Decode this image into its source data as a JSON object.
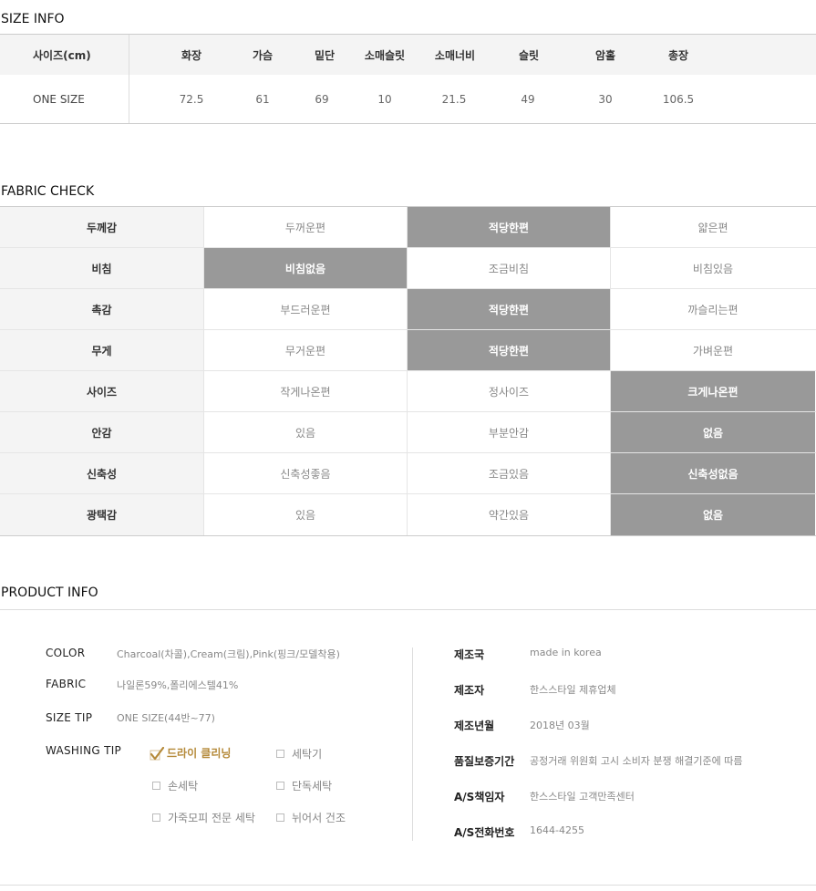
{
  "size_info": {
    "title": "SIZE INFO",
    "header_first": "사이즈(cm)",
    "columns": [
      "화장",
      "가슴",
      "밑단",
      "소매슬릿",
      "소매너비",
      "슬릿",
      "암홀",
      "총장"
    ],
    "row_label": "ONE SIZE",
    "values": [
      "72.5",
      "61",
      "69",
      "10",
      "21.5",
      "49",
      "30",
      "106.5"
    ]
  },
  "fabric_check": {
    "title": "FABRIC CHECK",
    "rows": [
      {
        "label": "두께감",
        "options": [
          "두꺼운편",
          "적당한편",
          "얇은편"
        ],
        "selected": 1
      },
      {
        "label": "비침",
        "options": [
          "비침없음",
          "조금비침",
          "비침있음"
        ],
        "selected": 0
      },
      {
        "label": "촉감",
        "options": [
          "부드러운편",
          "적당한편",
          "까슬리는편"
        ],
        "selected": 1
      },
      {
        "label": "무게",
        "options": [
          "무거운편",
          "적당한편",
          "가벼운편"
        ],
        "selected": 1
      },
      {
        "label": "사이즈",
        "options": [
          "작게나온편",
          "정사이즈",
          "크게나온편"
        ],
        "selected": 2
      },
      {
        "label": "안감",
        "options": [
          "있음",
          "부분안감",
          "없음"
        ],
        "selected": 2
      },
      {
        "label": "신축성",
        "options": [
          "신축성좋음",
          "조금있음",
          "신축성없음"
        ],
        "selected": 2
      },
      {
        "label": "광택감",
        "options": [
          "있음",
          "약간있음",
          "없음"
        ],
        "selected": 2
      }
    ],
    "selected_color": "#999999"
  },
  "product_info": {
    "title": "PRODUCT INFO",
    "color_label": "COLOR",
    "color_value": "Charcoal(차콜),Cream(크림),Pink(핑크/모델착용)",
    "fabric_label": "FABRIC",
    "fabric_value": "나일론59%,폴리에스텔41%",
    "sizetip_label": "SIZE TIP",
    "sizetip_value": "ONE SIZE(44반~77)",
    "washing_label": "WASHING TIP",
    "washing": {
      "dry_cleaning": "드라이 클리닝",
      "washer": "세탁기",
      "hand_wash": "손세탁",
      "separate_wash": "단독세탁",
      "leather_pro": "가죽모피 전문 세탁",
      "lay_flat_dry": "뉘어서 건조"
    },
    "washing_checked_color": "#b58a3a",
    "right": [
      {
        "label": "제조국",
        "value": "made in korea"
      },
      {
        "label": "제조자",
        "value": "한스스타일 제휴업체"
      },
      {
        "label": "제조년월",
        "value": "2018년 03월"
      },
      {
        "label": "품질보증기간",
        "value": "공정거래 위원회 고시 소비자 분쟁 해결기준에 따름"
      },
      {
        "label": "A/S책임자",
        "value": "한스스타일 고객만족센터"
      },
      {
        "label": "A/S전화번호",
        "value": "1644-4255"
      }
    ]
  }
}
